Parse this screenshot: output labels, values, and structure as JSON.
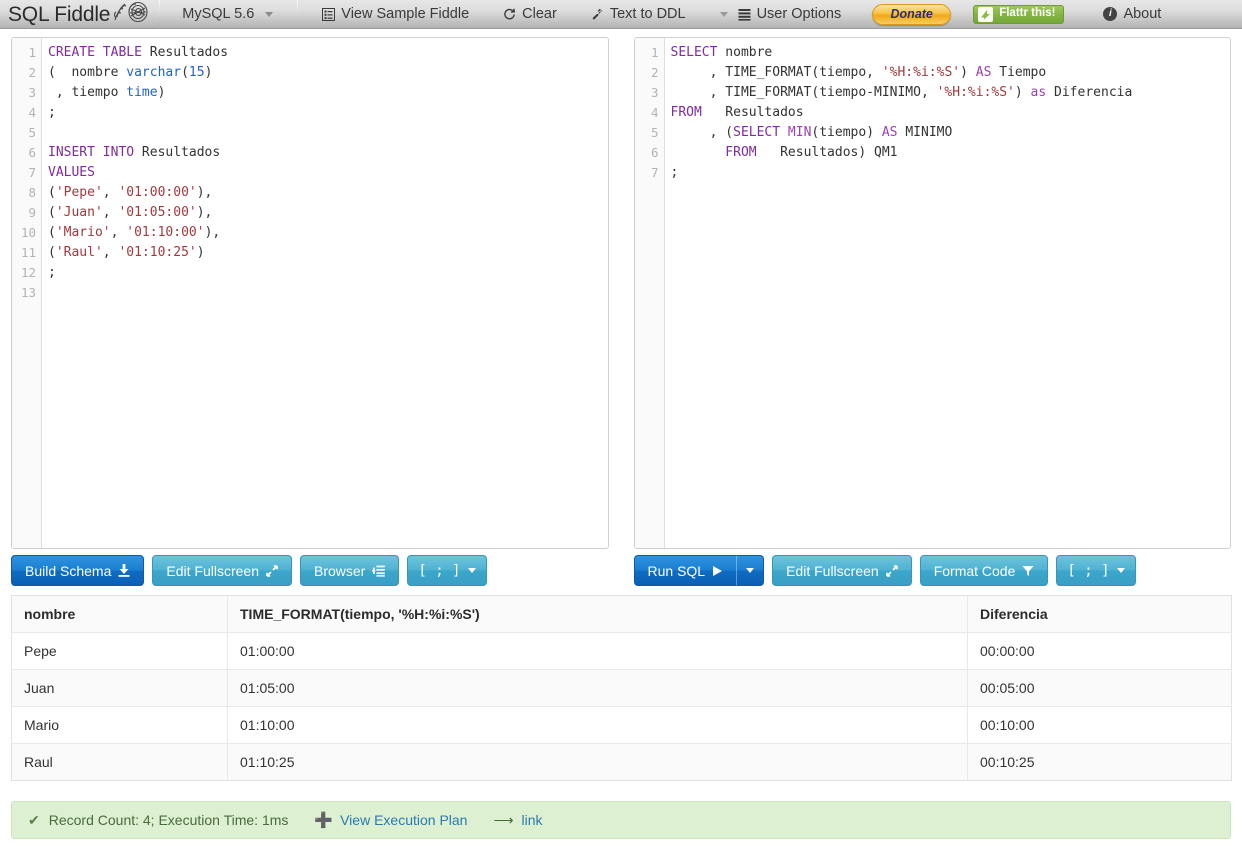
{
  "header": {
    "brand": "SQL Fiddle",
    "brand_logo_icon": "fiddlehead-fern-icon",
    "db_selector": {
      "label": "MySQL 5.6",
      "icon": "chevron-down-icon"
    },
    "nav": [
      {
        "label": "View Sample Fiddle",
        "icon": "document-list-icon"
      },
      {
        "label": "Clear",
        "icon": "refresh-icon"
      },
      {
        "label": "Text to DDL",
        "icon": "wrench-icon"
      },
      {
        "label": "User Options",
        "icon": "lines-menu-icon",
        "pre_icon": "chevron-down-icon"
      }
    ],
    "donate": {
      "label": "Donate",
      "icon": "donate-button"
    },
    "flattr": {
      "label": "Flattr this!",
      "icon": "flattr-icon"
    },
    "about": {
      "label": "About",
      "icon": "info-circle-icon"
    }
  },
  "schema_editor": {
    "name": "schema-panel",
    "line_numbers": [
      "1",
      "2",
      "3",
      "4",
      "5",
      "6",
      "7",
      "8",
      "9",
      "10",
      "11",
      "12",
      "13"
    ],
    "lines": [
      [
        {
          "t": "CREATE TABLE",
          "c": "kw"
        },
        {
          "t": " Resultados",
          "c": "pl"
        }
      ],
      [
        {
          "t": "(  nombre ",
          "c": "pl"
        },
        {
          "t": "varchar",
          "c": "typ"
        },
        {
          "t": "(",
          "c": "pl"
        },
        {
          "t": "15",
          "c": "num"
        },
        {
          "t": ")",
          "c": "pl"
        }
      ],
      [
        {
          "t": " , tiempo ",
          "c": "pl"
        },
        {
          "t": "time",
          "c": "typ"
        },
        {
          "t": ")",
          "c": "pl"
        }
      ],
      [
        {
          "t": ";",
          "c": "pl"
        }
      ],
      [
        {
          "t": "",
          "c": "pl"
        }
      ],
      [
        {
          "t": "INSERT INTO",
          "c": "kw"
        },
        {
          "t": " Resultados",
          "c": "pl"
        }
      ],
      [
        {
          "t": "VALUES",
          "c": "kw"
        }
      ],
      [
        {
          "t": "(",
          "c": "pl"
        },
        {
          "t": "'Pepe'",
          "c": "str"
        },
        {
          "t": ", ",
          "c": "pl"
        },
        {
          "t": "'01:00:00'",
          "c": "str"
        },
        {
          "t": "),",
          "c": "pl"
        }
      ],
      [
        {
          "t": "(",
          "c": "pl"
        },
        {
          "t": "'Juan'",
          "c": "str"
        },
        {
          "t": ", ",
          "c": "pl"
        },
        {
          "t": "'01:05:00'",
          "c": "str"
        },
        {
          "t": "),",
          "c": "pl"
        }
      ],
      [
        {
          "t": "(",
          "c": "pl"
        },
        {
          "t": "'Mario'",
          "c": "str"
        },
        {
          "t": ", ",
          "c": "pl"
        },
        {
          "t": "'01:10:00'",
          "c": "str"
        },
        {
          "t": "),",
          "c": "pl"
        }
      ],
      [
        {
          "t": "(",
          "c": "pl"
        },
        {
          "t": "'Raul'",
          "c": "str"
        },
        {
          "t": ", ",
          "c": "pl"
        },
        {
          "t": "'01:10:25'",
          "c": "str"
        },
        {
          "t": ")",
          "c": "pl"
        }
      ],
      [
        {
          "t": ";",
          "c": "pl"
        }
      ],
      [
        {
          "t": "",
          "c": "pl"
        }
      ]
    ]
  },
  "query_editor": {
    "name": "query-panel",
    "line_numbers": [
      "1",
      "2",
      "3",
      "4",
      "5",
      "6",
      "7"
    ],
    "lines": [
      [
        {
          "t": "SELECT",
          "c": "kw"
        },
        {
          "t": " nombre",
          "c": "pl"
        }
      ],
      [
        {
          "t": "     , TIME_FORMAT(tiempo, ",
          "c": "pl"
        },
        {
          "t": "'%H:%i:%S'",
          "c": "str"
        },
        {
          "t": ") ",
          "c": "pl"
        },
        {
          "t": "AS",
          "c": "kw2"
        },
        {
          "t": " Tiempo",
          "c": "pl"
        }
      ],
      [
        {
          "t": "     , TIME_FORMAT(tiempo-MINIMO, ",
          "c": "pl"
        },
        {
          "t": "'%H:%i:%S'",
          "c": "str"
        },
        {
          "t": ") ",
          "c": "pl"
        },
        {
          "t": "as",
          "c": "kw2"
        },
        {
          "t": " Diferencia",
          "c": "pl"
        }
      ],
      [
        {
          "t": "FROM",
          "c": "kw"
        },
        {
          "t": "   Resultados",
          "c": "pl"
        }
      ],
      [
        {
          "t": "     , (",
          "c": "pl"
        },
        {
          "t": "SELECT",
          "c": "kw"
        },
        {
          "t": " ",
          "c": "pl"
        },
        {
          "t": "MIN",
          "c": "kw2"
        },
        {
          "t": "(tiempo) ",
          "c": "pl"
        },
        {
          "t": "AS",
          "c": "kw2"
        },
        {
          "t": " MINIMO",
          "c": "pl"
        }
      ],
      [
        {
          "t": "       ",
          "c": "pl"
        },
        {
          "t": "FROM",
          "c": "kw"
        },
        {
          "t": "   Resultados) QM1",
          "c": "pl"
        }
      ],
      [
        {
          "t": ";",
          "c": "pl"
        }
      ]
    ]
  },
  "schema_buttons": [
    {
      "label": "Build Schema",
      "icon": "download-icon",
      "style": "primary"
    },
    {
      "label": "Edit Fullscreen",
      "icon": "expand-arrows-icon",
      "style": "teal"
    },
    {
      "label": "Browser",
      "icon": "browser-list-icon",
      "style": "teal"
    },
    {
      "label": "[ ; ]",
      "icon": "chevron-down-icon",
      "style": "teal"
    }
  ],
  "query_buttons": [
    {
      "label": "Run SQL",
      "icon": "play-icon",
      "style": "primary"
    },
    {
      "label": "",
      "icon": "chevron-down-icon",
      "style": "split"
    },
    {
      "label": "Edit Fullscreen",
      "icon": "expand-arrows-icon",
      "style": "teal"
    },
    {
      "label": "Format Code",
      "icon": "filter-icon",
      "style": "teal"
    },
    {
      "label": "[ ; ]",
      "icon": "chevron-down-icon",
      "style": "teal"
    }
  ],
  "results": {
    "columns": [
      "nombre",
      "TIME_FORMAT(tiempo, '%H:%i:%S')",
      "Diferencia"
    ],
    "rows": [
      [
        "Pepe",
        "01:00:00",
        "00:00:00"
      ],
      [
        "Juan",
        "01:05:00",
        "00:05:00"
      ],
      [
        "Mario",
        "01:10:00",
        "00:10:00"
      ],
      [
        "Raul",
        "01:10:25",
        "00:10:25"
      ]
    ]
  },
  "status": {
    "check_icon": "checkmark-icon",
    "text": "Record Count: 4; Execution Time: 1ms",
    "execution_plan": {
      "label": "View Execution Plan",
      "icon": "plus-icon"
    },
    "link": {
      "label": "link",
      "icon": "arrow-share-icon"
    }
  },
  "colors": {
    "primary_blue": "#0f6cc2",
    "teal": "#3ba6cb",
    "status_green_bg": "#ddf0d2",
    "link_blue": "#2a7ab0",
    "keyword_purple": "#7f2a9e",
    "string_red": "#a3383d",
    "type_blue": "#1d62d6"
  }
}
